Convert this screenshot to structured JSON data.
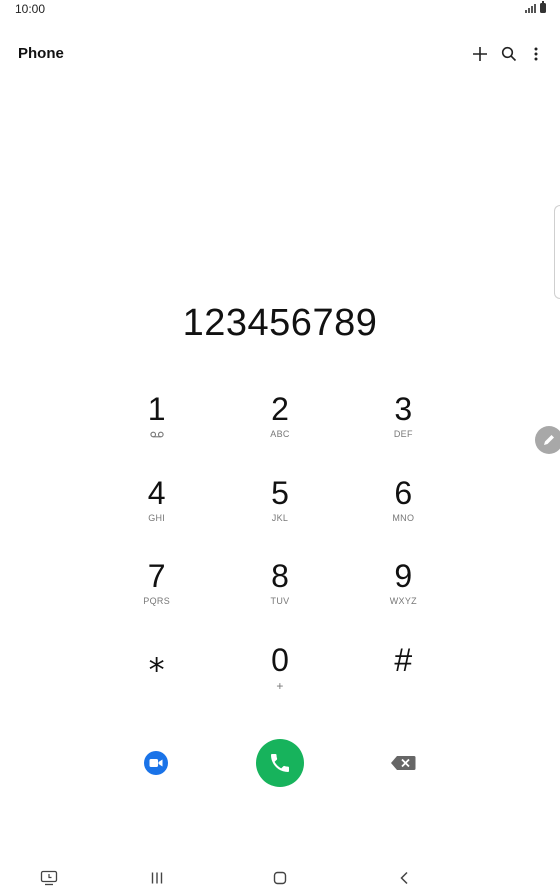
{
  "status_bar": {
    "time": "10:00",
    "icons": [
      "signal-icon",
      "battery-icon"
    ]
  },
  "header": {
    "title": "Phone",
    "actions": [
      "add-icon",
      "search-icon",
      "more-vert-icon"
    ]
  },
  "dialer": {
    "entered_number": "123456789",
    "keys": [
      {
        "digit": "1",
        "letters": "",
        "icon": "voicemail-icon"
      },
      {
        "digit": "2",
        "letters": "ABC"
      },
      {
        "digit": "3",
        "letters": "DEF"
      },
      {
        "digit": "4",
        "letters": "GHI"
      },
      {
        "digit": "5",
        "letters": "JKL"
      },
      {
        "digit": "6",
        "letters": "MNO"
      },
      {
        "digit": "7",
        "letters": "PQRS"
      },
      {
        "digit": "8",
        "letters": "TUV"
      },
      {
        "digit": "9",
        "letters": "WXYZ"
      },
      {
        "digit": "⁎",
        "letters": ""
      },
      {
        "digit": "0",
        "letters": "+"
      },
      {
        "digit": "#",
        "letters": ""
      }
    ]
  },
  "actions": {
    "video_call_icon": "video-call-icon",
    "call_icon": "phone-icon",
    "backspace_icon": "backspace-icon",
    "edit_icon": "pencil-icon"
  },
  "colors": {
    "call_green": "#17b35c",
    "video_blue": "#1a73e8",
    "edit_gray": "#a8a8a8"
  },
  "nav_bar": {
    "buttons": [
      "screen-icon",
      "recents-icon",
      "home-icon",
      "back-icon"
    ]
  }
}
